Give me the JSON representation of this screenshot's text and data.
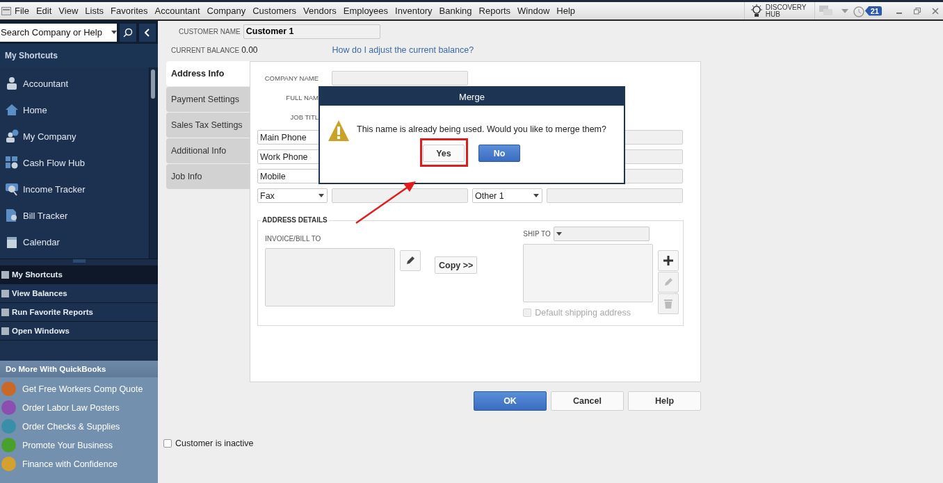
{
  "menu_bar": {
    "items": [
      "File",
      "Edit",
      "View",
      "Lists",
      "Favorites",
      "Accountant",
      "Company",
      "Customers",
      "Vendors",
      "Employees",
      "Inventory",
      "Banking",
      "Reports",
      "Window",
      "Help"
    ],
    "discovery_hub": "DISCOVERY HUB",
    "reminders_badge": "21"
  },
  "sidebar": {
    "search": {
      "placeholder": "Search Company or Help"
    },
    "shortcuts_title": "My Shortcuts",
    "shortcuts": [
      "Accountant",
      "Home",
      "My Company",
      "Cash Flow Hub",
      "Income Tracker",
      "Bill Tracker",
      "Calendar"
    ],
    "nav": [
      {
        "label": "My Shortcuts",
        "selected": true
      },
      {
        "label": "View Balances",
        "selected": false
      },
      {
        "label": "Run Favorite Reports",
        "selected": false
      },
      {
        "label": "Open Windows",
        "selected": false
      }
    ],
    "promo_title": "Do More With QuickBooks",
    "promos": [
      {
        "label": "Get Free Workers Comp Quote",
        "color": "#c8692a"
      },
      {
        "label": "Order Labor Law Posters",
        "color": "#8a4fb0"
      },
      {
        "label": "Order Checks & Supplies",
        "color": "#3a8fa8"
      },
      {
        "label": "Promote Your Business",
        "color": "#4aa02c"
      },
      {
        "label": "Finance with Confidence",
        "color": "#d4a030"
      }
    ]
  },
  "customer": {
    "name_label": "CUSTOMER NAME",
    "name": "Customer 1",
    "balance_label": "CURRENT BALANCE",
    "balance": "0.00",
    "balance_link": "How do I adjust the current balance?"
  },
  "tabs": [
    {
      "label": "Address Info",
      "selected": true
    },
    {
      "label": "Payment Settings",
      "selected": false
    },
    {
      "label": "Sales Tax Settings",
      "selected": false
    },
    {
      "label": "Additional Info",
      "selected": false
    },
    {
      "label": "Job Info",
      "selected": false
    }
  ],
  "name_fields": [
    "COMPANY NAME"
  ],
  "covered_name_labels": [
    "FULL NAM",
    "JOB TITL"
  ],
  "covered_phone_rows": [
    "Main Phone",
    "Work Phone"
  ],
  "phone_rows": [
    {
      "left": "Mobile"
    },
    {
      "left": "Fax",
      "right": "Other 1"
    }
  ],
  "address": {
    "title": "ADDRESS DETAILS",
    "bill_to": "INVOICE/BILL TO",
    "copy": "Copy >>",
    "ship_to": "SHIP TO",
    "ship_buttons": [
      {
        "disabled": false
      },
      {
        "disabled": true
      },
      {
        "disabled": true
      }
    ],
    "default_shipping": {
      "label": "Default shipping address",
      "checked": false,
      "disabled": true
    }
  },
  "buttons": [
    "OK",
    "Cancel",
    "Help"
  ],
  "inactive": {
    "label": "Customer is inactive",
    "checked": false
  },
  "dialog": {
    "title": "Merge",
    "message": "This name is already being used. Would you like to merge them?",
    "buttons": [
      {
        "label": "Yes",
        "selected": false
      },
      {
        "label": "No",
        "selected": true
      }
    ]
  }
}
